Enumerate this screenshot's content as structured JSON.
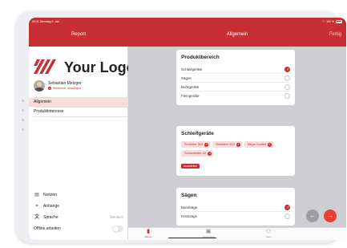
{
  "status": {
    "time": "09:41",
    "date": "Dienstag 9. Jan",
    "battery": "100 %"
  },
  "navbar": {
    "left_title": "Report",
    "center_title": "Allgemein",
    "action_label": "Fertig"
  },
  "sidebar": {
    "logo_text": "Your Logo",
    "user": {
      "name": "Sebastian Metzger",
      "subtitle": "Teilnehmer hinzufügen"
    },
    "items": [
      {
        "label": "Allgemein",
        "active": true
      },
      {
        "label": "Produktinteresse",
        "active": false
      }
    ],
    "bottom": {
      "notes_label": "Notizen",
      "attachments_label": "Anhänge",
      "language_label": "Sprache",
      "language_value": "Deutsch",
      "offline_label": "Offline arbeiten",
      "offline_on": false
    }
  },
  "cards": {
    "produktbereich": {
      "title": "Produktbereich",
      "items": [
        {
          "label": "Schleifgeräte",
          "checked": true
        },
        {
          "label": "Sägen",
          "checked": false
        },
        {
          "label": "Bohrgeräte",
          "checked": false
        },
        {
          "label": "Fleingeräte",
          "checked": false
        }
      ]
    },
    "schleifgeraete": {
      "title": "Schleifgeräte",
      "chips": [
        "Schleifer 300",
        "Schleifer 400",
        "Mega-Schleif",
        "Schschleifer 42"
      ],
      "button_label": "Auswählen"
    },
    "saegen": {
      "title": "Sägen",
      "items": [
        {
          "label": "Bandsäge",
          "checked": true
        },
        {
          "label": "Kreissäge",
          "checked": false
        }
      ]
    }
  },
  "tabbar": {
    "tabs": [
      {
        "label": "Report",
        "icon": "document-icon",
        "active": true
      },
      {
        "label": "Visitenkarte",
        "icon": "card-scan-icon",
        "active": false
      },
      {
        "label": "Team",
        "icon": "people-icon",
        "active": false
      }
    ]
  },
  "colors": {
    "brand": "#c62f33",
    "fab": "#e2422f"
  }
}
